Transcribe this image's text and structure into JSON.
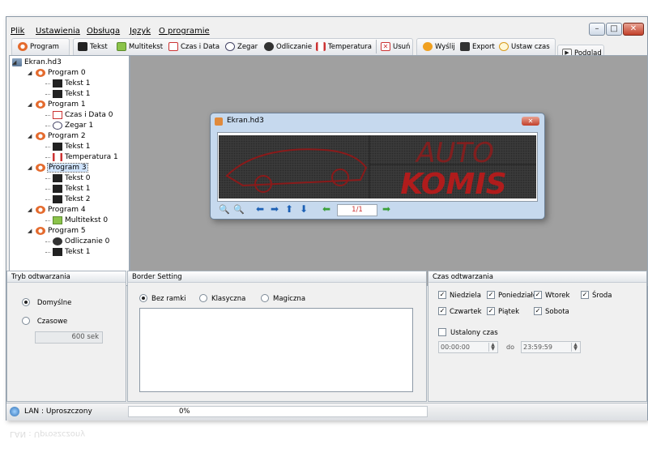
{
  "menu": [
    "Plik",
    "Ustawienia",
    "Obsługa",
    "Język",
    "O programie"
  ],
  "toolbar": {
    "program": "Program",
    "tekst": "Tekst",
    "multitekst": "Multitekst",
    "czas_data": "Czas i Data",
    "zegar": "Zegar",
    "odliczanie": "Odliczanie",
    "temperatura": "Temperatura",
    "usun": "Usuń",
    "wyslij": "Wyślij",
    "export": "Export",
    "ustaw_czas": "Ustaw czas",
    "podglad": "Podgląd"
  },
  "tree": {
    "root": "Ekran.hd3",
    "items": [
      {
        "label": "Program 0",
        "level": 1
      },
      {
        "label": "Tekst 1",
        "level": 2
      },
      {
        "label": "Tekst 1",
        "level": 2
      },
      {
        "label": "Program 1",
        "level": 1
      },
      {
        "label": "Czas i Data 0",
        "level": 2
      },
      {
        "label": "Zegar 1",
        "level": 2
      },
      {
        "label": "Program 2",
        "level": 1
      },
      {
        "label": "Tekst 1",
        "level": 2
      },
      {
        "label": "Temperatura 1",
        "level": 2
      },
      {
        "label": "Program 3",
        "level": 1,
        "selected": true
      },
      {
        "label": "Tekst 0",
        "level": 2
      },
      {
        "label": "Tekst 1",
        "level": 2
      },
      {
        "label": "Tekst 2",
        "level": 2
      },
      {
        "label": "Program 4",
        "level": 1
      },
      {
        "label": "Multitekst 0",
        "level": 2
      },
      {
        "label": "Program 5",
        "level": 1
      },
      {
        "label": "Odliczanie 0",
        "level": 2
      },
      {
        "label": "Tekst 1",
        "level": 2
      }
    ]
  },
  "preview": {
    "title": "Ekran.hd3",
    "led_line1": "AUTO",
    "led_line2": "KOMIS",
    "page": "1/1",
    "led_color": "#b01c1c"
  },
  "playback": {
    "title": "Tryb odtwarzania",
    "default_label": "Domyślne",
    "timed_label": "Czasowe",
    "duration": "600 sek"
  },
  "border": {
    "title": "Border Setting",
    "options": [
      "Bez ramki",
      "Klasyczna",
      "Magiczna"
    ]
  },
  "schedule": {
    "title": "Czas odtwarzania",
    "days_row1": [
      "Niedziela",
      "Poniedziałek",
      "Wtorek",
      "Środa"
    ],
    "days_row2": [
      "Czwartek",
      "Piątek",
      "Sobota"
    ],
    "fixed_time_label": "Ustalony czas",
    "from": "00:00:00",
    "to_label": "do",
    "to": "23:59:59"
  },
  "status": {
    "connection": "LAN : Uproszczony",
    "progress": "0%"
  },
  "colors": {
    "accent": "#3a6ea5",
    "led": "#b01c1c"
  }
}
